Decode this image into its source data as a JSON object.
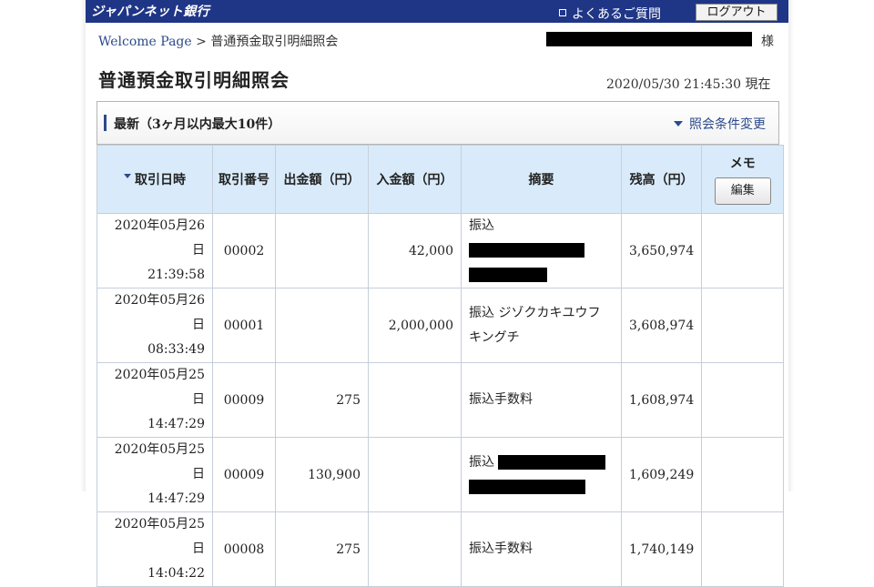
{
  "header": {
    "logo": "ジャパンネット銀行",
    "faq_label": "よくあるご質問",
    "logout_label": "ログアウト"
  },
  "breadcrumb": {
    "home": "Welcome Page",
    "separator": ">",
    "current": "普通預金取引明細照会"
  },
  "user": {
    "honorific": "様"
  },
  "page": {
    "title": "普通預金取引明細照会",
    "timestamp": "2020/05/30 21:45:30",
    "timestamp_suffix": "現在"
  },
  "panel": {
    "title": "最新（3ヶ月以内最大10件）",
    "condition_link": "照会条件変更"
  },
  "table": {
    "headers": {
      "date": "取引日時",
      "number": "取引番号",
      "withdrawal": "出金額（円）",
      "deposit": "入金額（円）",
      "description": "摘要",
      "balance": "残高（円）",
      "memo": "メモ",
      "edit": "編集"
    },
    "rows": [
      {
        "date": "2020年05月26日",
        "time": "21:39:58",
        "number": "00002",
        "withdrawal": "",
        "deposit": "42,000",
        "desc1": "振込",
        "desc2": "",
        "balance": "3,650,974"
      },
      {
        "date": "2020年05月26日",
        "time": "08:33:49",
        "number": "00001",
        "withdrawal": "",
        "deposit": "2,000,000",
        "desc1": "振込 ジゾクカキユウフ",
        "desc2": "キングチ",
        "balance": "3,608,974"
      },
      {
        "date": "2020年05月25日",
        "time": "14:47:29",
        "number": "00009",
        "withdrawal": "275",
        "deposit": "",
        "desc1": "振込手数料",
        "desc2": "",
        "balance": "1,608,974"
      },
      {
        "date": "2020年05月25日",
        "time": "14:47:29",
        "number": "00009",
        "withdrawal": "130,900",
        "deposit": "",
        "desc1": "振込",
        "desc2": "",
        "balance": "1,609,249"
      },
      {
        "date": "2020年05月25日",
        "time": "14:04:22",
        "number": "00008",
        "withdrawal": "275",
        "deposit": "",
        "desc1": "振込手数料",
        "desc2": "",
        "balance": "1,740,149"
      }
    ]
  },
  "colors": {
    "brand": "#1f3586",
    "link": "#2c4a8c",
    "table_header": "#d9ebfa"
  }
}
